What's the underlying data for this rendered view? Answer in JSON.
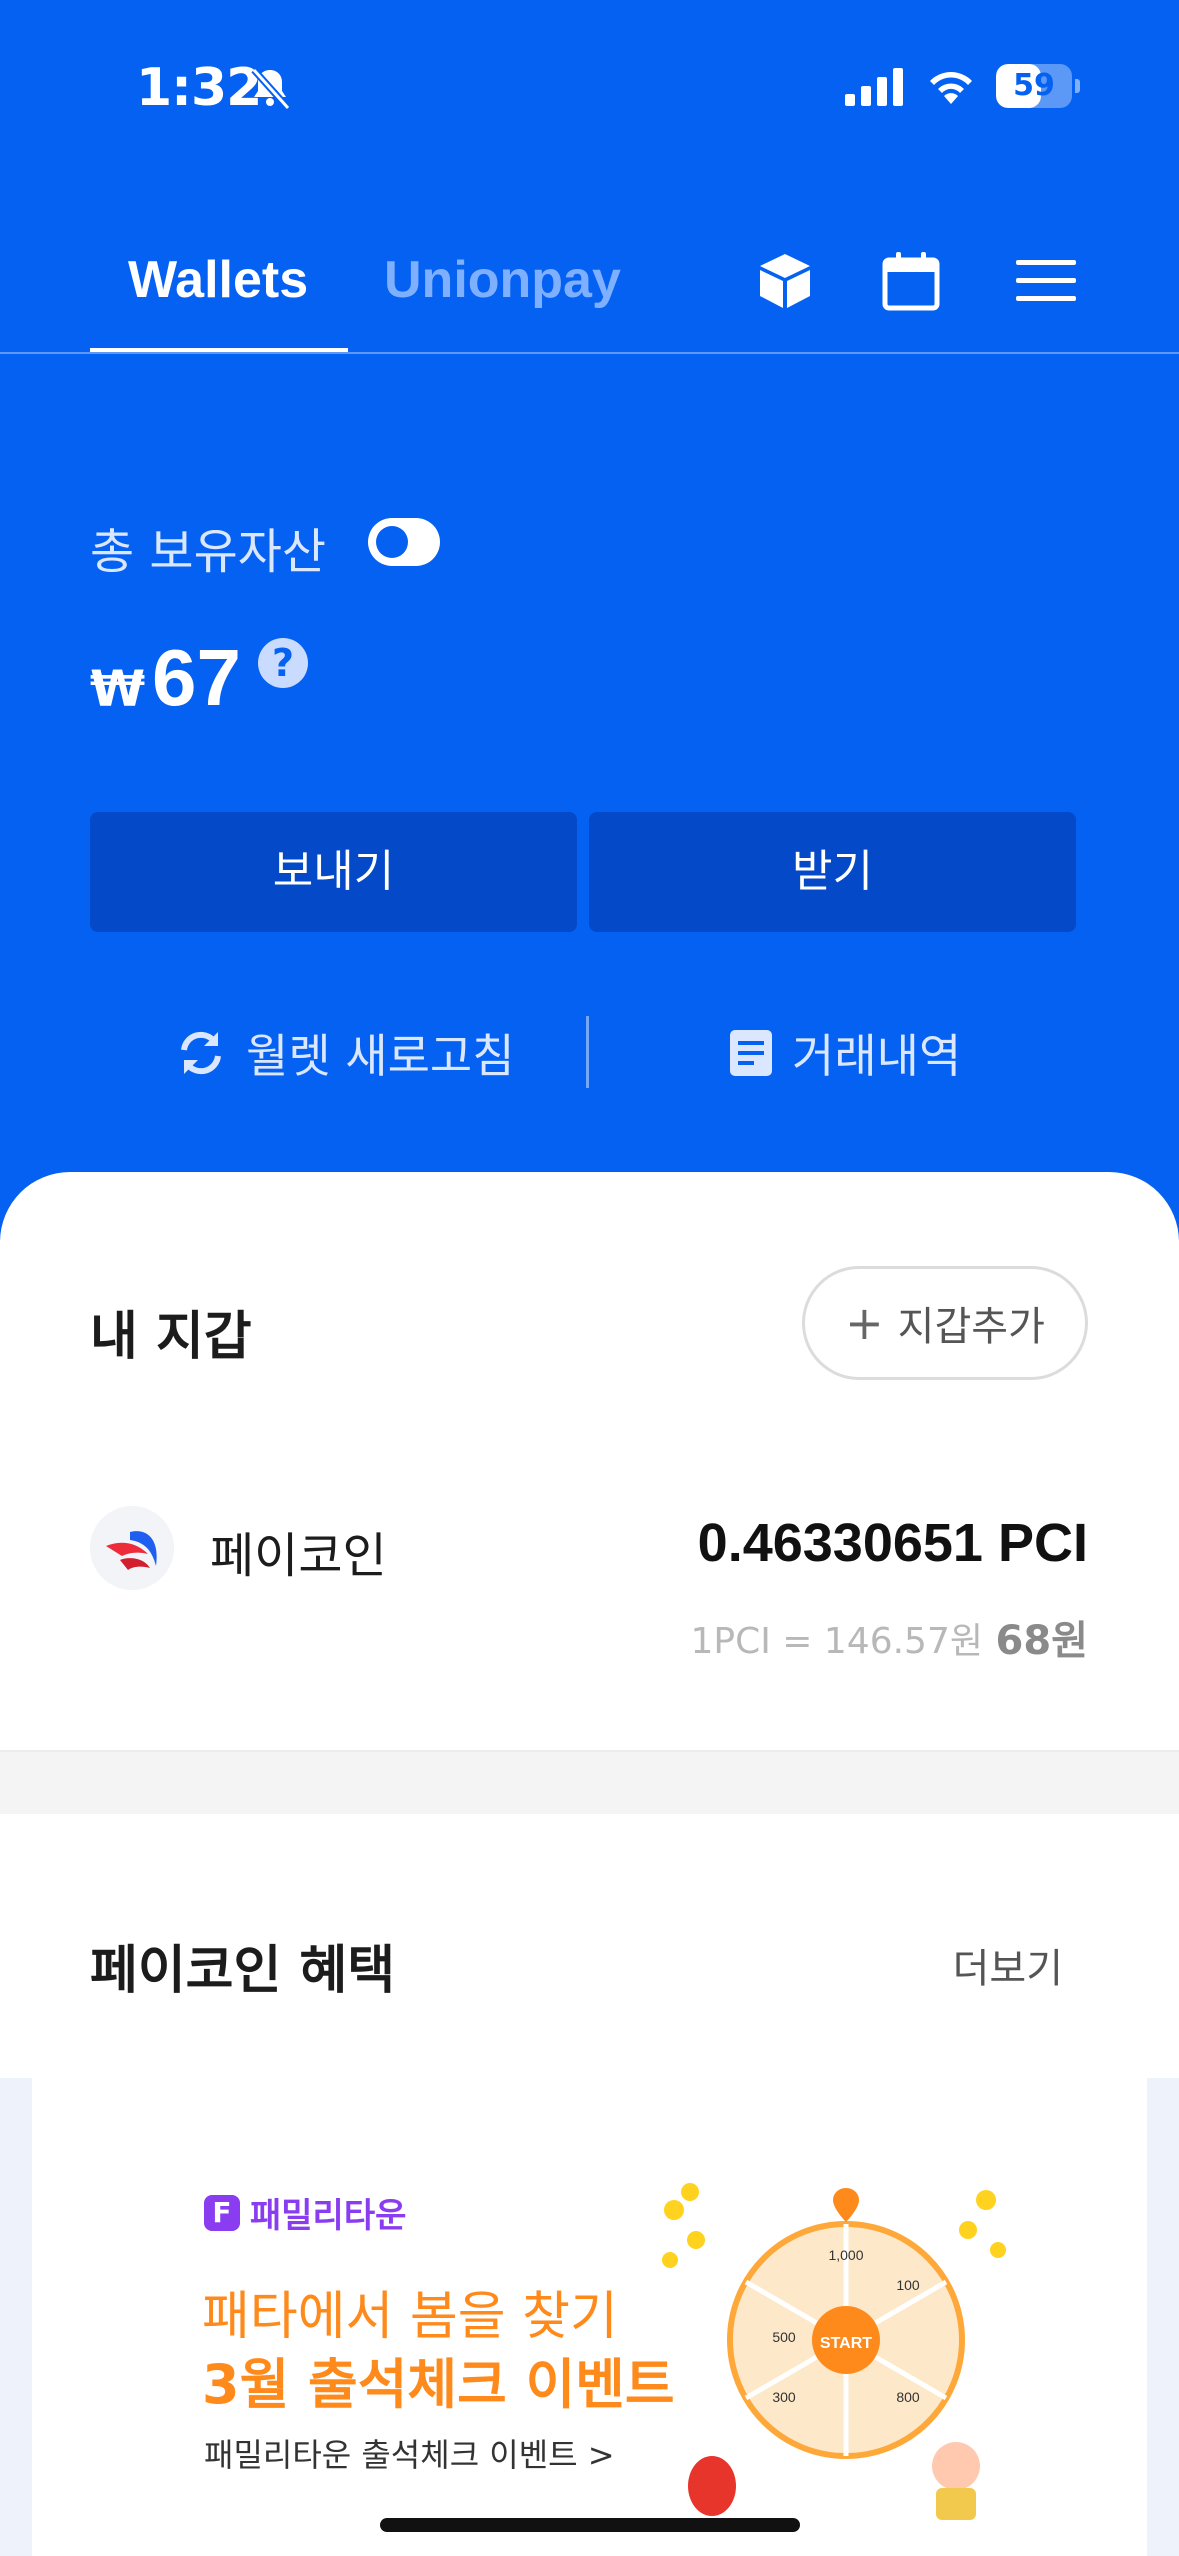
{
  "status_bar": {
    "time": "1:32",
    "battery": "59",
    "battery_level": 0.59
  },
  "header": {
    "tabs": [
      {
        "label": "Wallets",
        "active": true
      },
      {
        "label": "Unionpay",
        "active": false
      }
    ],
    "icons": [
      "cube-icon",
      "calendar-icon",
      "menu-icon"
    ]
  },
  "assets": {
    "label": "총 보유자산",
    "currency_symbol": "₩",
    "amount": "67",
    "help": "?"
  },
  "actions": {
    "send": "보내기",
    "receive": "받기",
    "refresh": "월렛 새로고침",
    "history": "거래내역"
  },
  "my_wallet": {
    "title": "내 지갑",
    "add_button": "지갑추가",
    "add_plus": "+",
    "coins": [
      {
        "name": "페이코인",
        "balance": "0.46330651 PCI",
        "rate": "1PCI = 146.57원",
        "krw": "68원"
      }
    ]
  },
  "benefits": {
    "title": "페이코인 혜택",
    "more": "더보기",
    "banner": {
      "brand": "패밀리타운",
      "brand_mark": "F",
      "line1": "패타에서 봄을 찾기",
      "line2": "3월 출석체크 이벤트",
      "sub": "패밀리타운 출석체크 이벤트 >",
      "wheel_center": "START",
      "wheel_values": [
        "1,000",
        "100",
        "800",
        "300",
        "500"
      ]
    }
  },
  "colors": {
    "primary": "#0561f1",
    "button": "#0349c8",
    "promo": "#ff8a1c",
    "brand": "#8a3cf0"
  }
}
